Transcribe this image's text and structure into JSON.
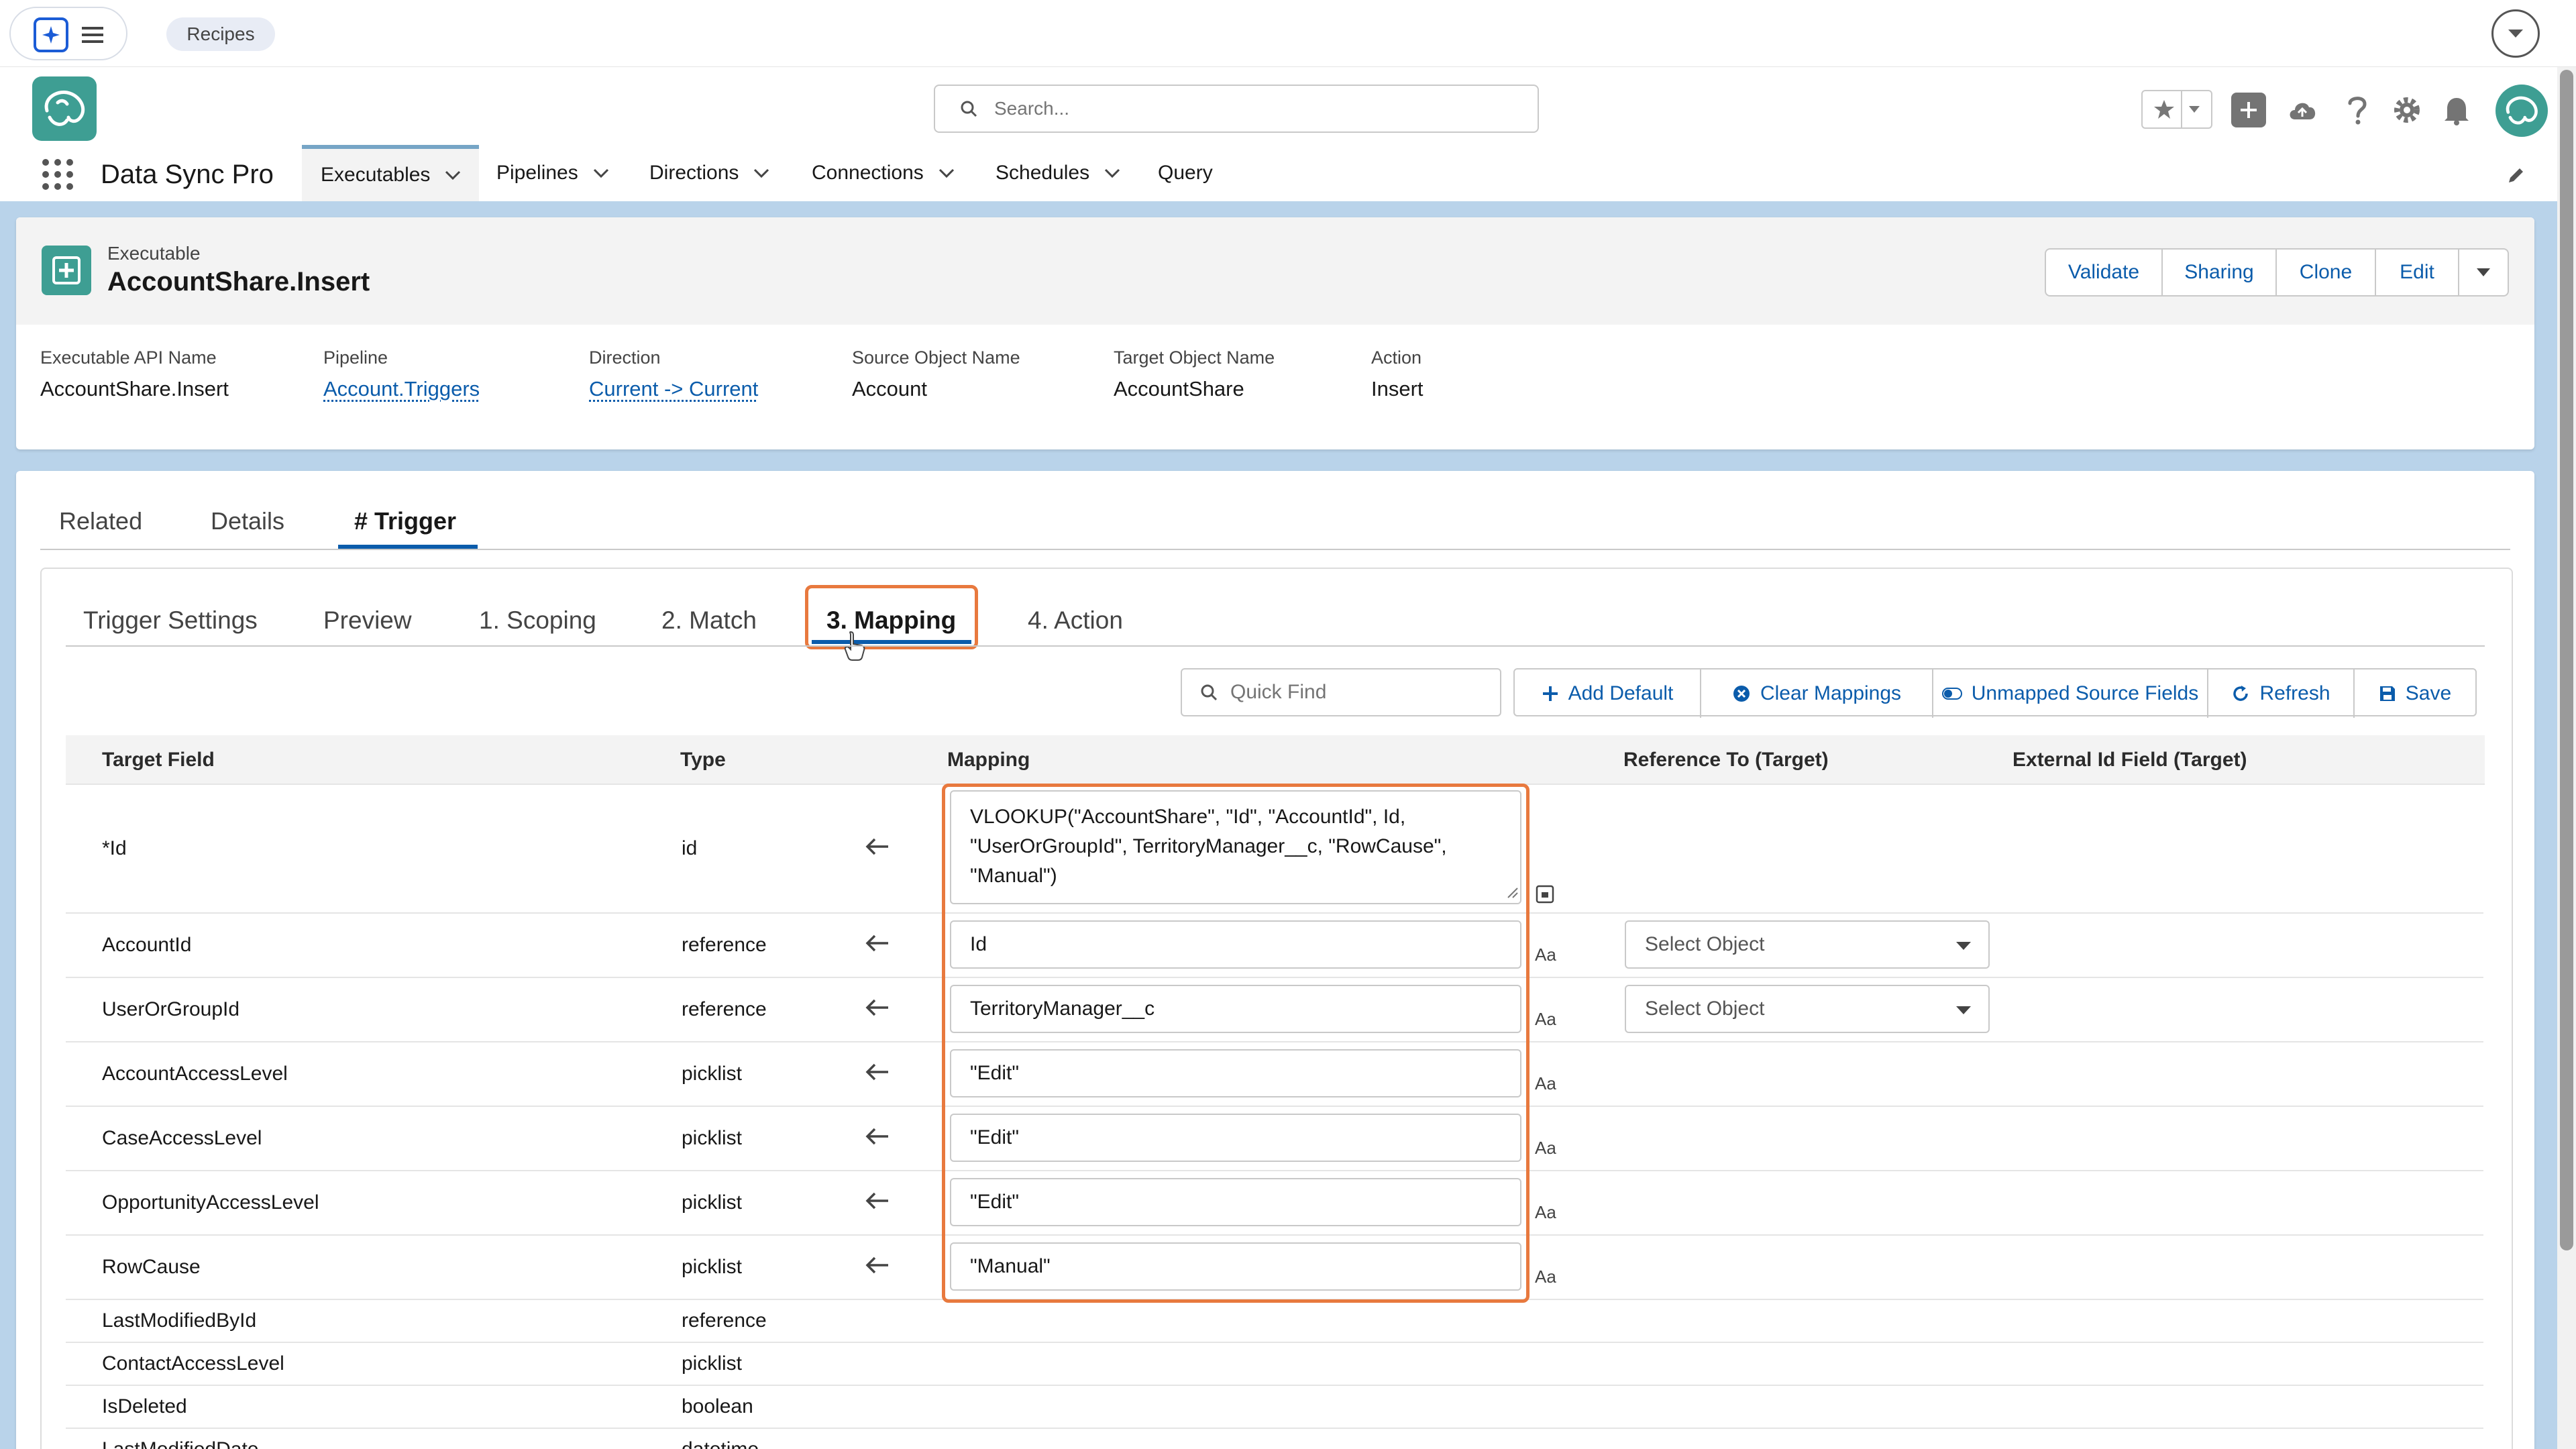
{
  "utility": {
    "recipes_label": "Recipes"
  },
  "header": {
    "search_placeholder": "Search..."
  },
  "nav": {
    "app_name": "Data Sync Pro",
    "items": [
      {
        "label": "Executables"
      },
      {
        "label": "Pipelines"
      },
      {
        "label": "Directions"
      },
      {
        "label": "Connections"
      },
      {
        "label": "Schedules"
      },
      {
        "label": "Query"
      }
    ]
  },
  "record": {
    "object_label": "Executable",
    "title": "AccountShare.Insert",
    "actions": [
      "Validate",
      "Sharing",
      "Clone",
      "Edit"
    ],
    "fields": [
      {
        "label": "Executable API Name",
        "value": "AccountShare.Insert"
      },
      {
        "label": "Pipeline",
        "value": "Account.Triggers"
      },
      {
        "label": "Direction",
        "value": "Current -> Current"
      },
      {
        "label": "Source Object Name",
        "value": "Account"
      },
      {
        "label": "Target Object Name",
        "value": "AccountShare"
      },
      {
        "label": "Action",
        "value": "Insert"
      }
    ]
  },
  "tabs": [
    "Related",
    "Details",
    "# Trigger"
  ],
  "subtabs": [
    "Trigger Settings",
    "Preview",
    "1. Scoping",
    "2. Match",
    "3. Mapping",
    "4. Action"
  ],
  "toolbar": {
    "quick_find_placeholder": "Quick Find",
    "buttons": [
      "Add Default",
      "Clear Mappings",
      "Unmapped Source Fields",
      "Refresh",
      "Save"
    ]
  },
  "table": {
    "headers": [
      "Target Field",
      "Type",
      "Mapping",
      "Reference To (Target)",
      "External Id Field (Target)"
    ],
    "select_placeholder": "Select Object",
    "rows": [
      {
        "field": "*Id",
        "type": "id",
        "mapping": "VLOOKUP(\"AccountShare\", \"Id\", \"AccountId\", Id, \"UserOrGroupId\", TerritoryManager__c, \"RowCause\", \"Manual\")"
      },
      {
        "field": "AccountId",
        "type": "reference",
        "mapping": "Id"
      },
      {
        "field": "UserOrGroupId",
        "type": "reference",
        "mapping": "TerritoryManager__c"
      },
      {
        "field": "AccountAccessLevel",
        "type": "picklist",
        "mapping": "\"Edit\""
      },
      {
        "field": "CaseAccessLevel",
        "type": "picklist",
        "mapping": "\"Edit\""
      },
      {
        "field": "OpportunityAccessLevel",
        "type": "picklist",
        "mapping": "\"Edit\""
      },
      {
        "field": "RowCause",
        "type": "picklist",
        "mapping": "\"Manual\""
      },
      {
        "field": "LastModifiedById",
        "type": "reference"
      },
      {
        "field": "ContactAccessLevel",
        "type": "picklist"
      },
      {
        "field": "IsDeleted",
        "type": "boolean"
      },
      {
        "field": "LastModifiedDate",
        "type": "datetime"
      }
    ]
  },
  "icons": {
    "aa": "Aa"
  },
  "colors": {
    "accent": "#0b5cab",
    "highlight": "#e8793e",
    "brand": "#3e9e93",
    "page_bg": "#b9d3ea"
  }
}
